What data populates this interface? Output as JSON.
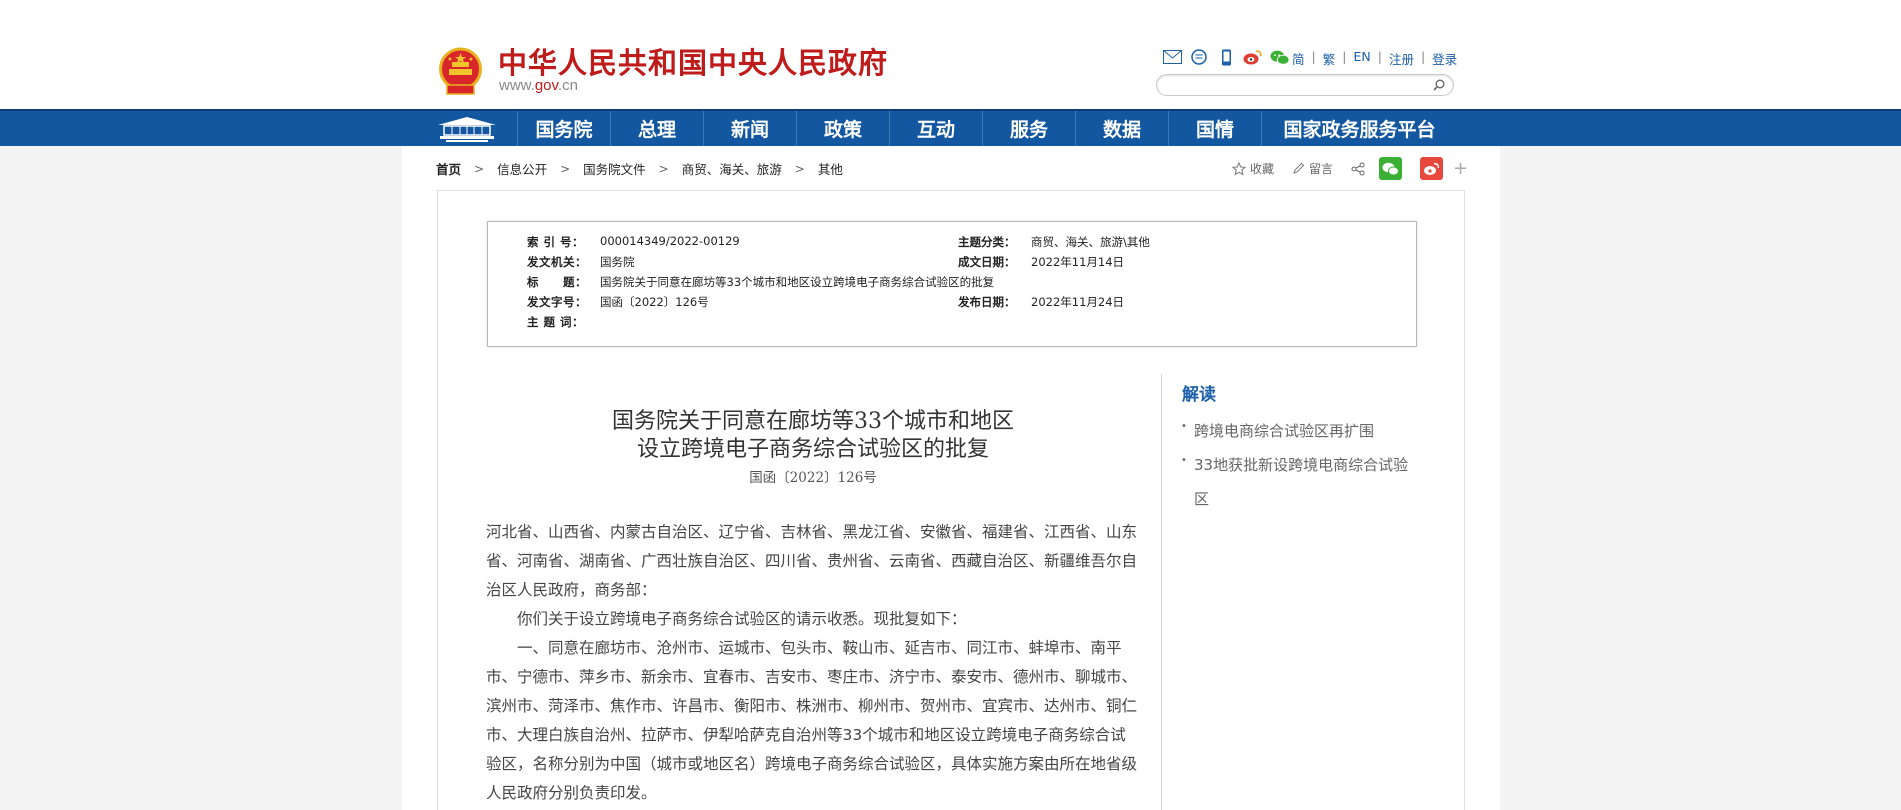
{
  "header": {
    "title": "中华人民共和国中央人民政府",
    "url_prefix": "www.",
    "url_highlight": "gov",
    "url_suffix": ".cn",
    "languages": [
      "简",
      "繁",
      "EN",
      "注册",
      "登录"
    ],
    "search_placeholder": ""
  },
  "nav": {
    "items": [
      "国务院",
      "总理",
      "新闻",
      "政策",
      "互动",
      "服务",
      "数据",
      "国情",
      "国家政务服务平台"
    ]
  },
  "breadcrumb": [
    "首页",
    "信息公开",
    "国务院文件",
    "商贸、海关、旅游",
    "其他"
  ],
  "share": {
    "favorite": "收藏",
    "comment": "留言"
  },
  "meta": {
    "index_label": "索 引 号：",
    "index_value": "000014349/2022-00129",
    "category_label": "主题分类：",
    "category_value": "商贸、海关、旅游\\其他",
    "issuer_label": "发文机关：",
    "issuer_value": "国务院",
    "created_label": "成文日期：",
    "created_value": "2022年11月14日",
    "title_label": "标　　题：",
    "title_value": "国务院关于同意在廊坊等33个城市和地区设立跨境电子商务综合试验区的批复",
    "docnum_label": "发文字号：",
    "docnum_value": "国函〔2022〕126号",
    "published_label": "发布日期：",
    "published_value": "2022年11月24日",
    "keywords_label": "主 题 词："
  },
  "document": {
    "title_line1": "国务院关于同意在廊坊等33个城市和地区",
    "title_line2": "设立跨境电子商务综合试验区的批复",
    "doc_number": "国函〔2022〕126号",
    "p1": "河北省、山西省、内蒙古自治区、辽宁省、吉林省、黑龙江省、安徽省、福建省、江西省、山东省、河南省、湖南省、广西壮族自治区、四川省、贵州省、云南省、西藏自治区、新疆维吾尔自治区人民政府，商务部：",
    "p2": "你们关于设立跨境电子商务综合试验区的请示收悉。现批复如下：",
    "p3": "一、同意在廊坊市、沧州市、运城市、包头市、鞍山市、延吉市、同江市、蚌埠市、南平市、宁德市、萍乡市、新余市、宜春市、吉安市、枣庄市、济宁市、泰安市、德州市、聊城市、滨州市、菏泽市、焦作市、许昌市、衡阳市、株洲市、柳州市、贺州市、宜宾市、达州市、铜仁市、大理白族自治州、拉萨市、伊犁哈萨克自治州等33个城市和地区设立跨境电子商务综合试验区，名称分别为中国（城市或地区名）跨境电子商务综合试验区，具体实施方案由所在地省级人民政府分别负责印发。"
  },
  "sidebar": {
    "title": "解读",
    "items": [
      "跨境电商综合试验区再扩围",
      "33地获批新设跨境电商综合试验区"
    ]
  }
}
